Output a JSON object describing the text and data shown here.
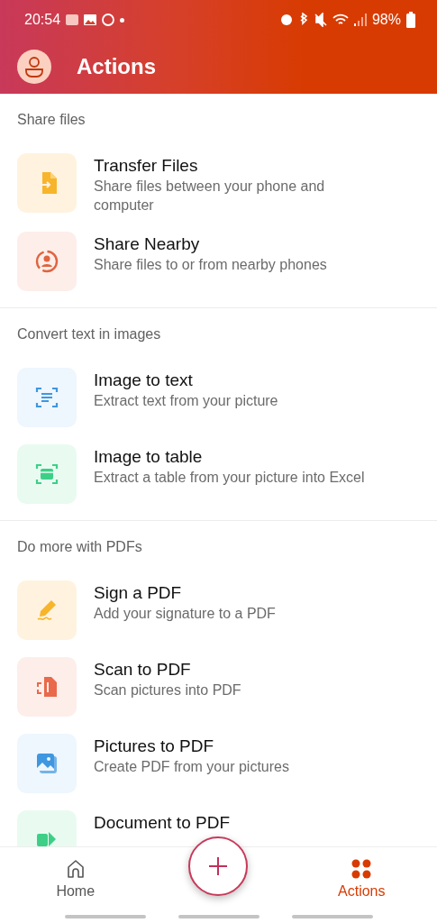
{
  "status_bar": {
    "time": "20:54",
    "battery": "98%"
  },
  "header": {
    "title": "Actions"
  },
  "sections": [
    {
      "title": "Share files",
      "items": [
        {
          "kind": "transfer",
          "title": "Transfer Files",
          "subtitle": "Share files between your phone and computer"
        },
        {
          "kind": "nearby",
          "title": "Share Nearby",
          "subtitle": "Share files to or from nearby phones"
        }
      ]
    },
    {
      "title": "Convert text in images",
      "items": [
        {
          "kind": "text",
          "title": "Image to text",
          "subtitle": "Extract text from your picture"
        },
        {
          "kind": "table",
          "title": "Image to table",
          "subtitle": "Extract a table from your picture into Excel"
        }
      ]
    },
    {
      "title": "Do more with PDFs",
      "items": [
        {
          "kind": "sign",
          "title": "Sign a PDF",
          "subtitle": "Add your signature to a PDF"
        },
        {
          "kind": "scan",
          "title": "Scan to PDF",
          "subtitle": "Scan pictures into PDF"
        },
        {
          "kind": "pictures",
          "title": "Pictures to PDF",
          "subtitle": "Create PDF from your pictures"
        },
        {
          "kind": "document",
          "title": "Document to PDF"
        }
      ]
    }
  ],
  "nav": [
    {
      "kind": "home",
      "label": "Home",
      "selected": false
    },
    {
      "kind": "actions",
      "label": "Actions",
      "selected": true
    }
  ]
}
